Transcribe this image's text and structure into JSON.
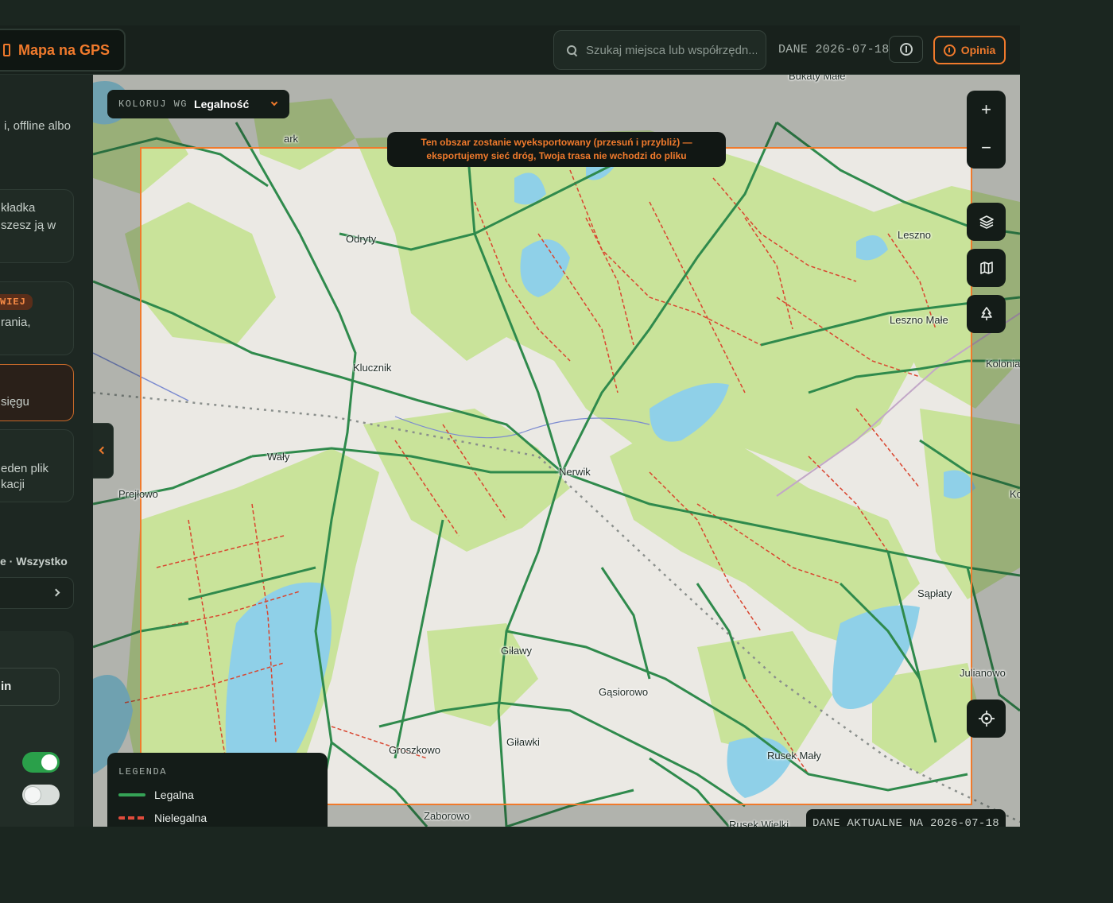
{
  "header": {
    "gps_button_label": "Mapa na GPS",
    "search_placeholder": "Szukaj miejsca lub współrzędn...",
    "data_date": "DANE 2026-07-18",
    "feedback_label": "Opinia"
  },
  "sidebar": {
    "intro_text": "i, offline albo",
    "card1_line1": "kładka",
    "card1_line2": "szesz ją w",
    "badge": "WIEJ",
    "card2_line1": "rania,",
    "card3_line1": "sięgu",
    "card4_line1": "eden plik",
    "card4_line2": "kacji",
    "tabs_text": "e  ·  Wszystko",
    "input_value": "in",
    "toggle1_on": true,
    "toggle2_on": false
  },
  "map": {
    "color_by_key": "KOLORUJ WG",
    "color_by_value": "Legalność",
    "export_banner_line1": "Ten obszar zostanie wyeksportowany (przesuń i przybliż) —",
    "export_banner_line2": "eksportujemy sieć dróg, Twoja trasa nie wchodzi do pliku",
    "zoom_in": "+",
    "zoom_out": "−",
    "legend": {
      "title": "LEGENDA",
      "legal": "Legalna",
      "illegal": "Nielegalna"
    },
    "data_current": "DANE AKTUALNE NA 2026-07-18",
    "attribution": "ⓘ",
    "places": {
      "odryty": "Odryty",
      "klucznik": "Klucznik",
      "waly": "Wały",
      "prejlowo": "Prejłowo",
      "nerwik": "Nerwik",
      "gilawy": "Giławy",
      "gasiorowo": "Gąsiorowo",
      "groszkowo": "Groszkowo",
      "gilawki": "Giławki",
      "zaborowo": "Zaborowo",
      "rusek_maly": "Rusek Mały",
      "rusek_wielki": "Rusek Wielki",
      "leszno": "Leszno",
      "leszno_male": "Leszno Małe",
      "kolonia": "Kolonia",
      "saplaty": "Sąpłaty",
      "julianowo": "Julianowo",
      "ark": "ark",
      "ko": "Ko",
      "bukaty": "Bukaty Małe"
    }
  },
  "colors": {
    "accent": "#f07a2c",
    "legal_road": "#35a356",
    "illegal_road": "#e04b3c",
    "forest": "#c9e39a",
    "water": "#8fd0e8"
  }
}
